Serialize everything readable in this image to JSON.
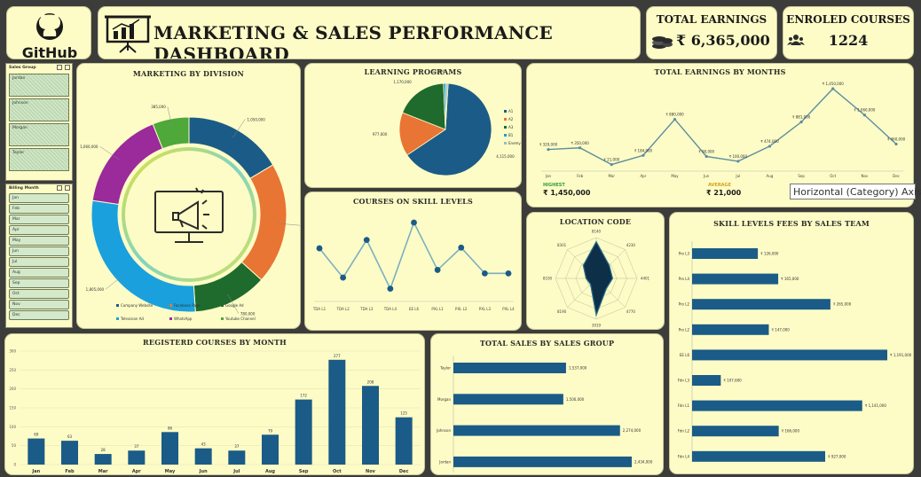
{
  "header": {
    "logo_text": "GitHub",
    "title": "MARKETING & SALES PERFORMANCE DASHBOARD",
    "total_earnings_label": "TOTAL EARNINGS",
    "total_earnings_value": "₹ 6,365,000",
    "enrolled_label": "ENROLED COURSES",
    "enrolled_value": "1224"
  },
  "slicers": {
    "sales_group": {
      "title": "Sales Group",
      "items": [
        "Jordan",
        "Johnson",
        "Morgan",
        "Taylor"
      ]
    },
    "billing_month": {
      "title": "Billing Month",
      "items": [
        "Jan",
        "Feb",
        "Mar",
        "Apr",
        "May",
        "Jun",
        "Jul",
        "Aug",
        "Sep",
        "Oct",
        "Nov",
        "Dec"
      ]
    }
  },
  "tooltip": "Horizontal (Category) Axis",
  "colors": {
    "primary": "#1b5b87",
    "orange": "#e87533",
    "green": "#1e6b2d",
    "light_blue": "#1aa0dd",
    "purple": "#9b2a9a",
    "lime": "#4ea83a",
    "panel": "#fdfcc6",
    "line": "#5b8ea0"
  },
  "chart_data": [
    {
      "id": "marketing_by_division",
      "type": "pie",
      "title": "MARKETING BY DIVISION",
      "labels": [
        "Company Website",
        "Facebook Page",
        "Google Ad",
        "Television Ad",
        "WhatsApp",
        "Youtube Channel"
      ],
      "values": [
        1050000,
        1285000,
        780000,
        1805000,
        1060000,
        385000
      ],
      "value_labels": [
        "1,050,000",
        "1,285,000",
        "780,000",
        "1,805,000",
        "1,060,000",
        "385,000"
      ],
      "legend_position": "bottom"
    },
    {
      "id": "learning_programs",
      "type": "pie",
      "title": "LEARNING PROGRAMS",
      "labels": [
        "A1",
        "A2",
        "A3",
        "B1",
        "Enemy"
      ],
      "values": [
        4115000,
        977000,
        1170000,
        57000,
        46000
      ],
      "value_labels": [
        "4,115,000",
        "977,000",
        "1,170,000",
        "57,000",
        ""
      ],
      "legend_position": "right"
    },
    {
      "id": "total_earnings_by_months",
      "type": "line",
      "title": "TOTAL EARNINGS BY MONTHS",
      "categories": [
        "Jan",
        "Feb",
        "Mar",
        "Apr",
        "May",
        "Jun",
        "Jul",
        "Aug",
        "Sep",
        "Oct",
        "Nov",
        "Dec"
      ],
      "values": [
        320000,
        350000,
        40000,
        210000,
        880000,
        190000,
        100000,
        380000,
        830000,
        1450000,
        960000,
        420000
      ],
      "value_labels": [
        "₹ 320,000",
        "₹ 350,000",
        "₹ 21,000",
        "₹ 184,000",
        "₹ 880,000",
        "₹ 90,000",
        "₹ 100,000",
        "₹ 474,000",
        "₹ 881,000",
        "₹ 1,450,000",
        "₹ 1,060,000",
        "₹ 460,000"
      ],
      "highest_label": "HIGHEST",
      "highest_value": "₹ 1,450,000",
      "average_label": "AVERAGE",
      "average_value": "₹ 21,000"
    },
    {
      "id": "courses_on_skill_levels",
      "type": "line",
      "title": "COURSES ON SKILL LEVELS",
      "categories": [
        "TDA L1",
        "TDA L2",
        "TDA L3",
        "TDA L4",
        "EE L6",
        "PXL L1",
        "PXL L2",
        "PXL L3",
        "PXL L4"
      ],
      "values": [
        122,
        38,
        146,
        6,
        196,
        60,
        124,
        50,
        50
      ]
    },
    {
      "id": "location_code",
      "type": "radar",
      "title": "LOCATION CODE",
      "categories": [
        "8140",
        "4230",
        "4401",
        "4770",
        "3019",
        "8190",
        "8100",
        "8301"
      ],
      "values": [
        0.9,
        0.45,
        0.4,
        0.35,
        0.9,
        0.2,
        0.25,
        0.45
      ]
    },
    {
      "id": "skill_levels_fees_by_sales_team",
      "type": "bar",
      "orientation": "horizontal",
      "title": "SKILL LEVELS FEES BY SALES TEAM",
      "categories": [
        "Pro L3",
        "Pro L4",
        "Pro L2",
        "Pro L2",
        "EE L6",
        "Fdn L3",
        "Fdn L1",
        "Fdn L2",
        "Fdn L4"
      ],
      "values": [
        126000,
        165000,
        265000,
        147000,
        374000,
        55000,
        326000,
        166000,
        255000
      ],
      "value_labels": [
        "₹ 126,000",
        "₹ 165,000",
        "₹ 265,000",
        "₹ 147,000",
        "₹ 1,191,000",
        "₹ 107,600",
        "₹ 1,141,000",
        "₹ 166,000",
        "₹ 927,000"
      ]
    },
    {
      "id": "registered_courses_by_month",
      "type": "bar",
      "title": "REGISTERD COURSES BY MONTH",
      "categories": [
        "Jan",
        "Feb",
        "Mar",
        "Apr",
        "May",
        "Jun",
        "Jul",
        "Aug",
        "Sep",
        "Oct",
        "Nov",
        "Dec"
      ],
      "values": [
        69,
        63,
        28,
        37,
        86,
        43,
        37,
        79,
        172,
        277,
        208,
        125
      ],
      "ylim": [
        0,
        300
      ],
      "yticks": [
        "0",
        "50",
        "100",
        "150",
        "200",
        "250",
        "300"
      ]
    },
    {
      "id": "total_sales_by_sales_group",
      "type": "bar",
      "orientation": "horizontal",
      "title": "TOTAL SALES BY SALES GROUP",
      "categories": [
        "Taylor",
        "Morgan",
        "Johnson",
        "Jordan"
      ],
      "values": [
        1537000,
        1500000,
        2274000,
        2434000
      ],
      "value_labels": [
        "1,537,000",
        "1,500,000",
        "2,274,000",
        "2,434,000"
      ]
    }
  ]
}
